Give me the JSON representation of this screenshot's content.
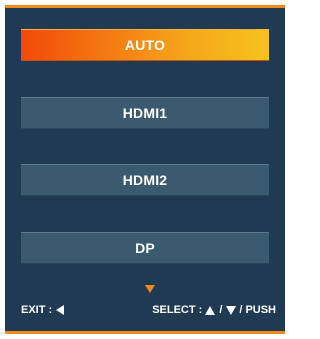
{
  "menu": {
    "items": [
      {
        "label": "AUTO",
        "selected": true
      },
      {
        "label": "HDMI1",
        "selected": false
      },
      {
        "label": "HDMI2",
        "selected": false
      },
      {
        "label": "DP",
        "selected": false
      }
    ],
    "more_indicator_icon": "chevron-down-triangle"
  },
  "footer": {
    "exit_label": "EXIT :",
    "exit_icon": "triangle-left",
    "select_label": "SELECT :",
    "select_icons": [
      "triangle-up",
      "triangle-down"
    ],
    "select_separator": "/",
    "select_suffix": "PUSH"
  },
  "colors": {
    "panel": "#1f3a52",
    "item": "#3a5a70",
    "accent": "#f08a1c",
    "selected_gradient_start": "#f24a08",
    "selected_gradient_end": "#f6c31e",
    "text": "#ffffff"
  }
}
